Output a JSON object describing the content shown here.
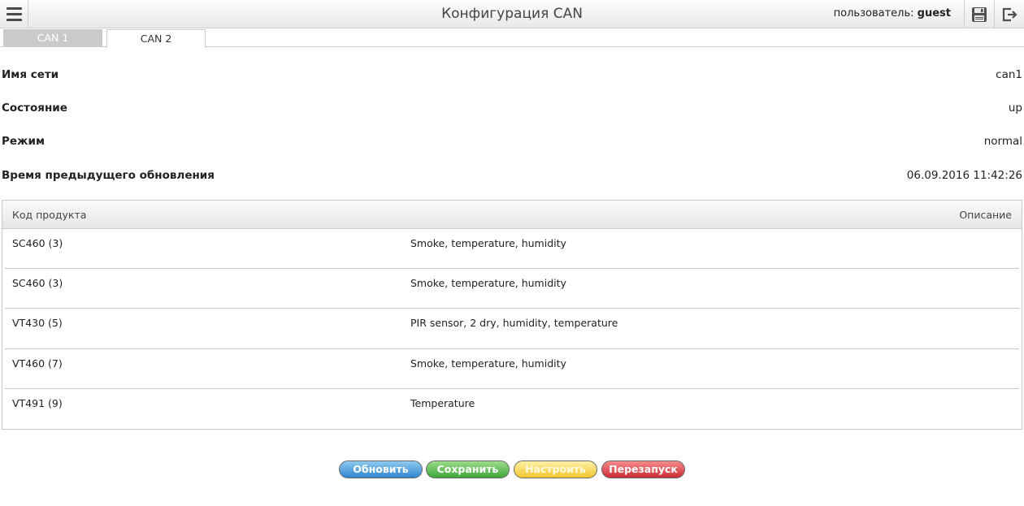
{
  "header": {
    "title": "Конфигурация CAN",
    "user_prefix": "пользователь:",
    "user_name": "guest",
    "icons": {
      "menu": "hamburger-menu-icon",
      "save": "floppy-disk-icon",
      "logout": "logout-icon"
    }
  },
  "tabs": [
    {
      "label": "CAN 1",
      "active": false
    },
    {
      "label": "CAN 2",
      "active": true
    }
  ],
  "info": [
    {
      "label": "Имя сети",
      "value": "can1"
    },
    {
      "label": "Состояние",
      "value": "up"
    },
    {
      "label": "Режим",
      "value": "normal"
    },
    {
      "label": "Время предыдущего обновления",
      "value": "06.09.2016 11:42:26"
    }
  ],
  "table": {
    "columns": [
      "Код продукта",
      "Описание"
    ],
    "rows": [
      {
        "code": "SC460 (3)",
        "description": "Smoke, temperature, humidity"
      },
      {
        "code": "SC460 (3)",
        "description": "Smoke, temperature, humidity"
      },
      {
        "code": "VT430 (5)",
        "description": "PIR sensor, 2 dry, humidity, temperature"
      },
      {
        "code": "VT460 (7)",
        "description": "Smoke, temperature, humidity"
      },
      {
        "code": "VT491 (9)",
        "description": "Temperature"
      }
    ]
  },
  "buttons": {
    "refresh": "Обновить",
    "save": "Сохранить",
    "configure": "Настроить",
    "restart": "Перезапуск"
  },
  "colors": {
    "refresh": "#2f86cf",
    "save": "#3fa63a",
    "configure": "#f1c62d",
    "restart": "#cc2d36"
  }
}
